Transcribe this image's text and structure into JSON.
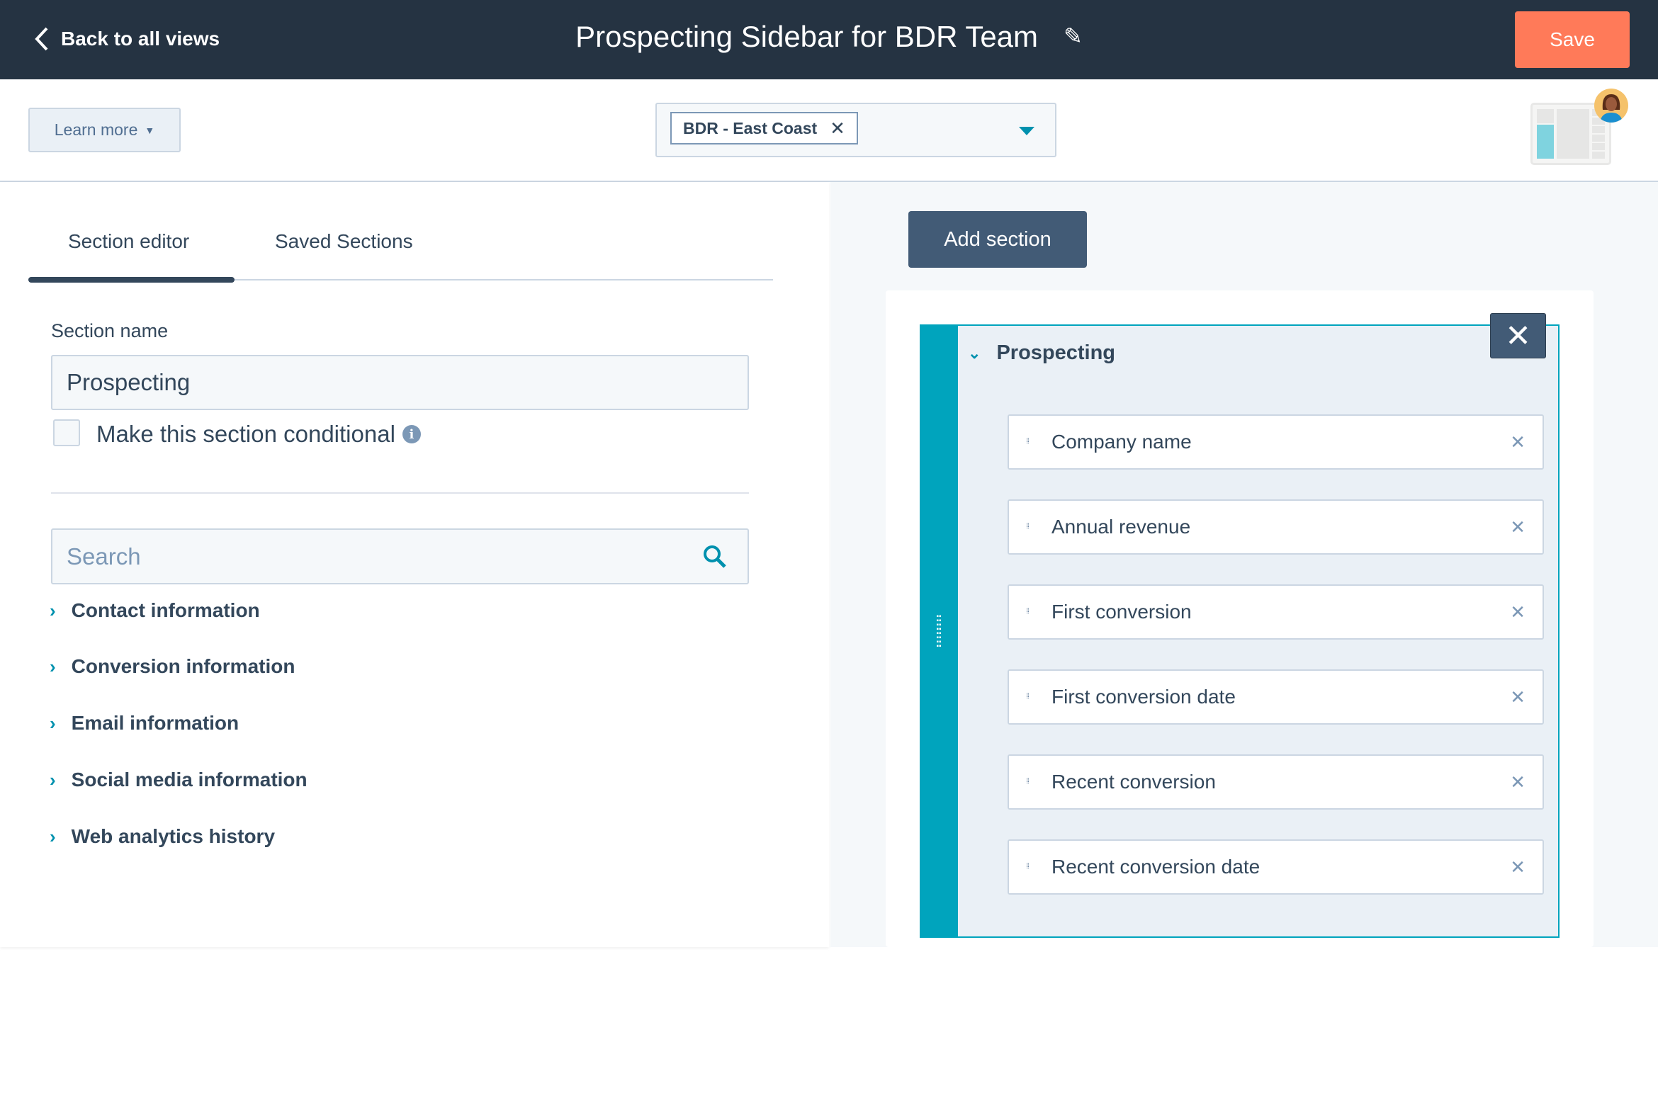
{
  "topbar": {
    "back_label": "Back to all views",
    "title": "Prospecting Sidebar for BDR Team",
    "save_label": "Save"
  },
  "subbar": {
    "learn_more_label": "Learn more",
    "selected_team": "BDR - East Coast"
  },
  "tabs": [
    {
      "label": "Section editor",
      "active": true
    },
    {
      "label": "Saved Sections",
      "active": false
    }
  ],
  "editor": {
    "section_name_label": "Section name",
    "section_name_value": "Prospecting",
    "conditional_label": "Make this section conditional",
    "conditional_checked": false,
    "search_placeholder": "Search",
    "groups": [
      "Contact information",
      "Conversion information",
      "Email information",
      "Social media information",
      "Web analytics history"
    ]
  },
  "preview": {
    "add_section_label": "Add section",
    "section_title": "Prospecting",
    "fields": [
      "Company name",
      "Annual revenue",
      "First conversion",
      "First conversion date",
      "Recent conversion",
      "Recent conversion date"
    ]
  },
  "colors": {
    "topbar": "#253342",
    "save": "#ff7a59",
    "accent": "#00a4bd",
    "dark_button": "#425b76"
  }
}
